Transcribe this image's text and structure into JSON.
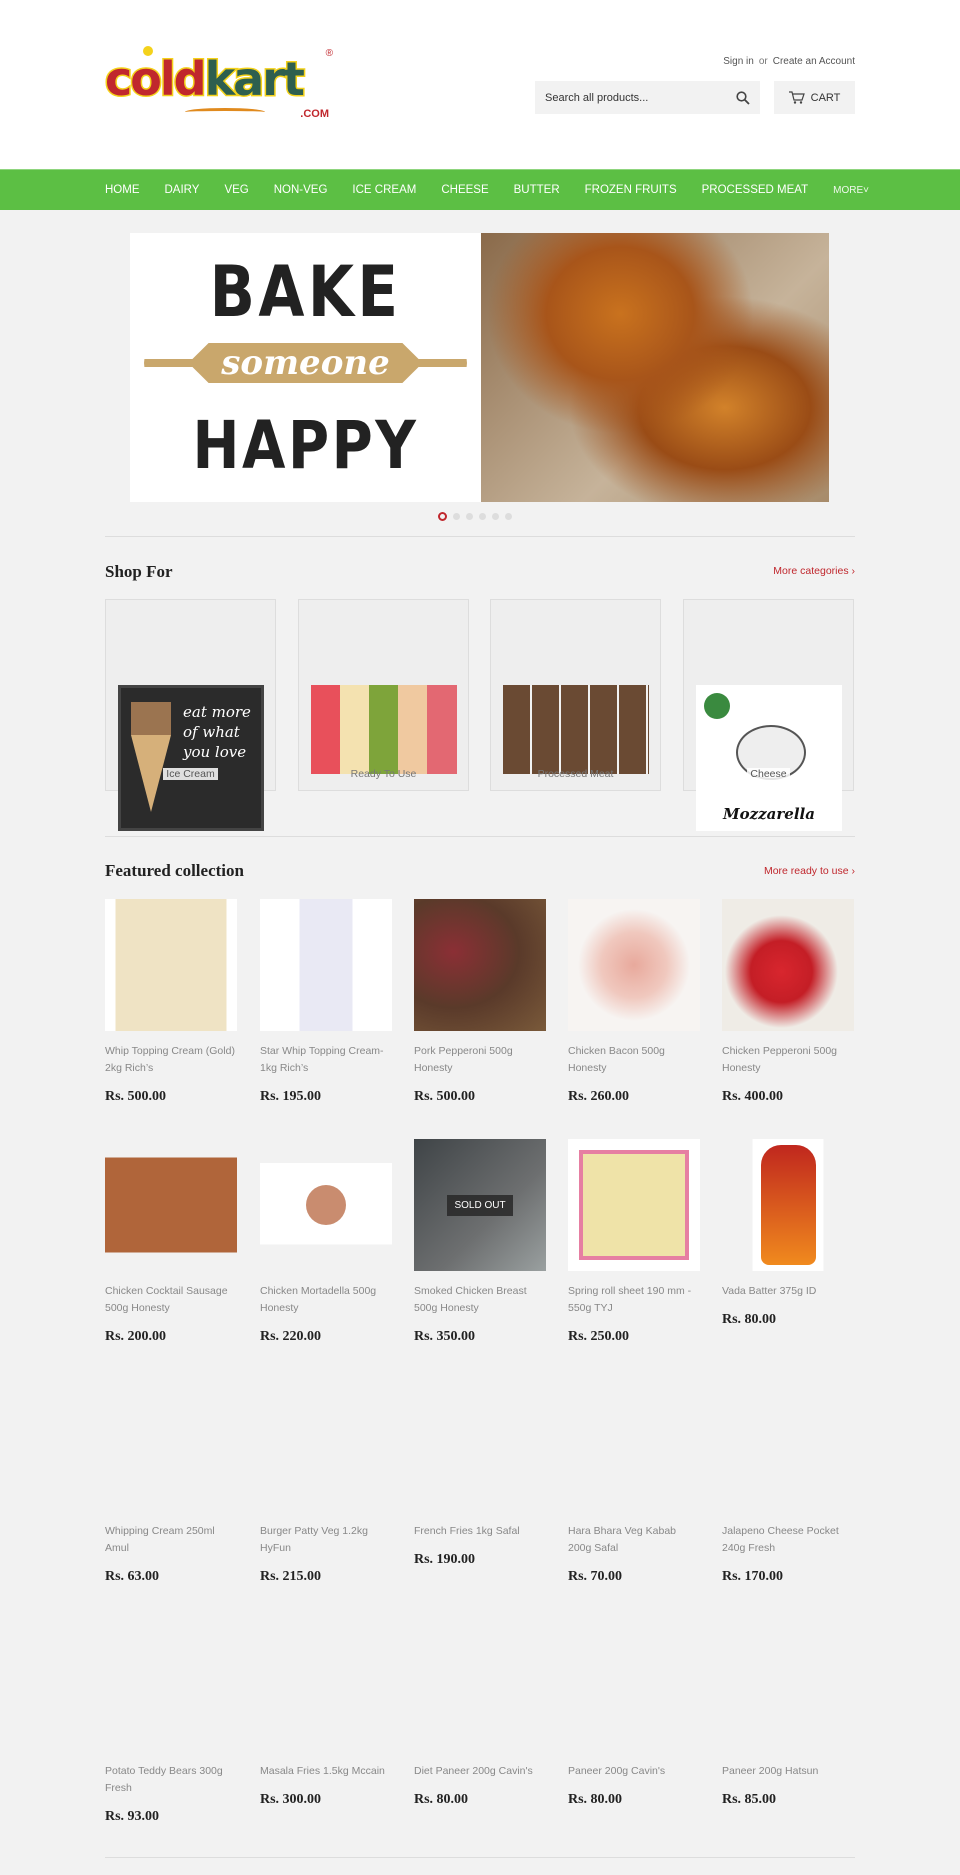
{
  "header": {
    "logo_text": "coldkart",
    "logo_suffix": ".COM",
    "sign_in": "Sign in",
    "or": "or",
    "create_account": "Create an Account",
    "search_placeholder": "Search all products...",
    "cart_label": "CART"
  },
  "nav": [
    "HOME",
    "DAIRY",
    "VEG",
    "NON-VEG",
    "ICE CREAM",
    "CHEESE",
    "BUTTER",
    "FROZEN FRUITS",
    "PROCESSED MEAT",
    "MORE"
  ],
  "banner": {
    "line1": "BAKE",
    "line2": "someone",
    "line3": "HAPPY",
    "slides": 6,
    "active_slide": 1
  },
  "shop_for": {
    "title": "Shop For",
    "more_link": "More categories ›",
    "categories": [
      {
        "label": "Ice Cream",
        "image_text": "eat more of what you love"
      },
      {
        "label": "Ready To Use"
      },
      {
        "label": "Processed Meat"
      },
      {
        "label": "Cheese",
        "image_text": "Mozzarella"
      }
    ]
  },
  "featured": {
    "title": "Featured collection",
    "more_link": "More ready to use ›",
    "sold_out_label": "SOLD OUT",
    "products": [
      {
        "title": "Whip Topping Cream (Gold) 2kg Rich’s",
        "price": "Rs. 500.00"
      },
      {
        "title": "Star Whip Topping Cream-1kg Rich’s",
        "price": "Rs. 195.00"
      },
      {
        "title": "Pork Pepperoni 500g Honesty",
        "price": "Rs. 500.00"
      },
      {
        "title": "Chicken Bacon 500g Honesty",
        "price": "Rs. 260.00"
      },
      {
        "title": "Chicken Pepperoni 500g Honesty",
        "price": "Rs. 400.00"
      },
      {
        "title": "Chicken Cocktail Sausage 500g Honesty",
        "price": "Rs. 200.00"
      },
      {
        "title": "Chicken Mortadella 500g Honesty",
        "price": "Rs. 220.00"
      },
      {
        "title": "Smoked Chicken Breast 500g Honesty",
        "price": "Rs. 350.00",
        "sold_out": true
      },
      {
        "title": "Spring roll sheet 190 mm - 550g TYJ",
        "price": "Rs. 250.00"
      },
      {
        "title": "Vada Batter 375g ID",
        "price": "Rs. 80.00"
      },
      {
        "title": "Whipping Cream 250ml Amul",
        "price": "Rs. 63.00"
      },
      {
        "title": "Burger Patty Veg 1.2kg HyFun",
        "price": "Rs. 215.00"
      },
      {
        "title": "French Fries 1kg Safal",
        "price": "Rs. 190.00"
      },
      {
        "title": "Hara Bhara Veg Kabab 200g Safal",
        "price": "Rs. 70.00"
      },
      {
        "title": "Jalapeno Cheese Pocket 240g Fresh",
        "price": "Rs. 170.00"
      },
      {
        "title": "Potato Teddy Bears 300g Fresh",
        "price": "Rs. 93.00"
      },
      {
        "title": "Masala Fries 1.5kg Mccain",
        "price": "Rs. 300.00"
      },
      {
        "title": "Diet Paneer 200g Cavin's",
        "price": "Rs. 80.00"
      },
      {
        "title": "Paneer 200g Cavin's",
        "price": "Rs. 80.00"
      },
      {
        "title": "Paneer 200g Hatsun",
        "price": "Rs. 85.00"
      }
    ]
  },
  "colors": {
    "nav_green": "#5cbf44",
    "accent_red": "#c0272d",
    "background": "#f2f2f2"
  }
}
